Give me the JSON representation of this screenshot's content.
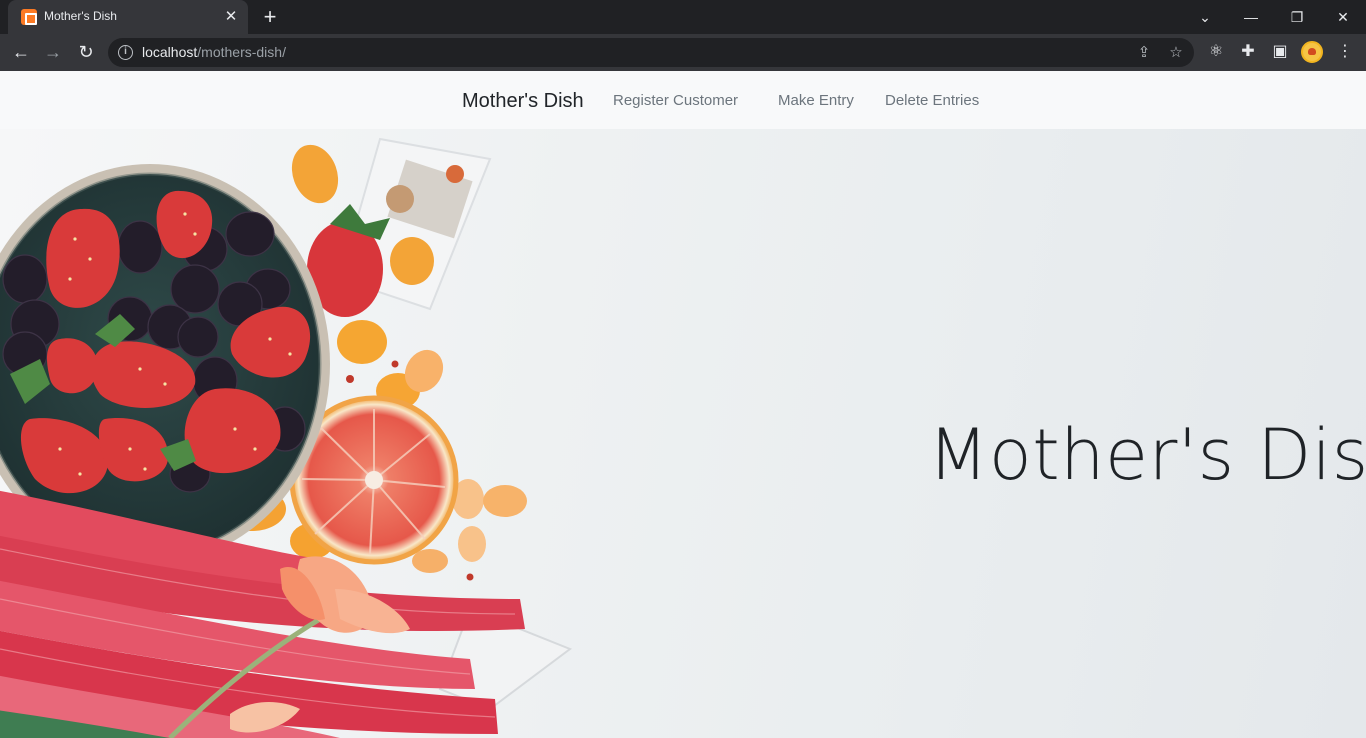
{
  "browser": {
    "tab_title": "Mother's Dish",
    "url_host": "localhost",
    "url_path": "/mothers-dish/"
  },
  "navbar": {
    "brand": "Mother's Dish",
    "links": [
      "Register Customer",
      "Make Entry",
      "Delete Entries"
    ]
  },
  "hero": {
    "title": "Mother's Dish"
  },
  "colors": {
    "tab_bar": "#202124",
    "toolbar": "#35363a",
    "navbar_bg": "#f8f9fa",
    "nav_link": "#6c757d",
    "strawberry": "#d93a3a",
    "rhubarb": "#e0485c",
    "orange": "#f5a436"
  },
  "icons": [
    "favicon-icon",
    "close-icon",
    "plus-icon",
    "chevron-down-icon",
    "minimize-icon",
    "restore-icon",
    "back-arrow-icon",
    "forward-arrow-icon",
    "reload-icon",
    "info-icon",
    "share-icon",
    "star-icon",
    "react-icon",
    "puzzle-icon",
    "side-panel-icon",
    "avatar",
    "kebab-menu-icon"
  ]
}
